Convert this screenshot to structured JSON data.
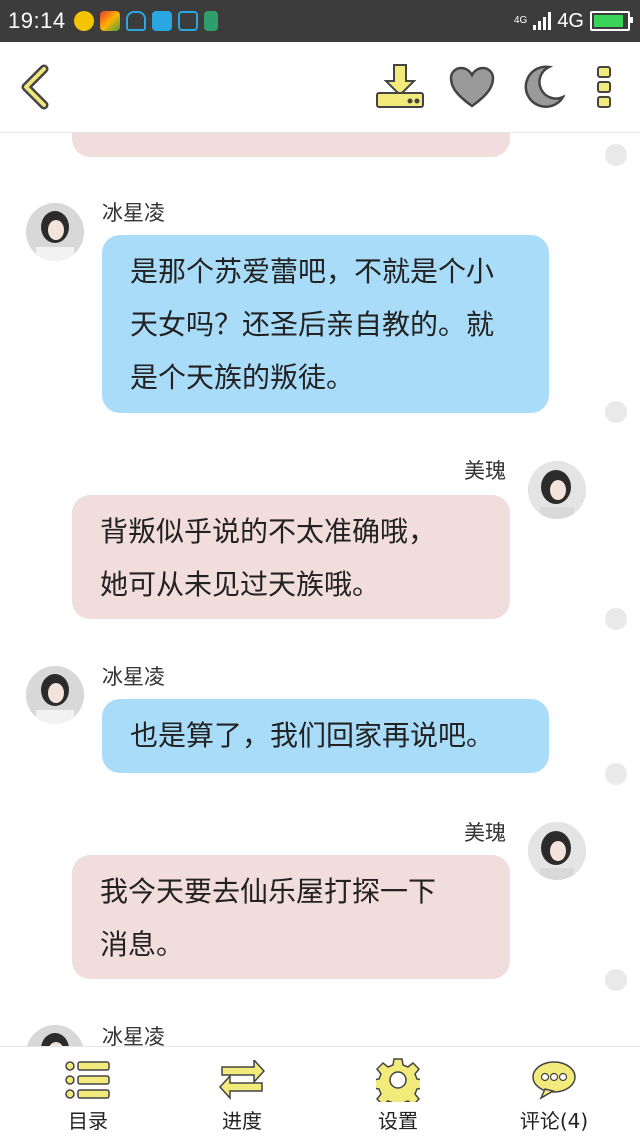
{
  "status_bar": {
    "time": "19:14",
    "network_small": "4G",
    "network": "4G",
    "icons": [
      "plus-app-icon",
      "color-app-icon",
      "headset-icon",
      "chat-app-icon",
      "scan-icon",
      "lock-icon"
    ]
  },
  "top_bar": {
    "icons": [
      "back-arrow-icon",
      "download-icon",
      "heart-icon",
      "night-mode-icon",
      "more-icon"
    ],
    "accent_color": "#e6df6a"
  },
  "messages": [
    {
      "speaker": "冰星凌",
      "side": "left",
      "color": "blue",
      "lines": [
        "是那个苏爱蕾吧，不就是个小",
        "天女吗？还圣后亲自教的。就",
        "是个天族的叛徒。"
      ]
    },
    {
      "speaker": "美瑰",
      "side": "right",
      "color": "pink",
      "lines": [
        "背叛似乎说的不太准确哦，",
        "她可从未见过天族哦。"
      ]
    },
    {
      "speaker": "冰星凌",
      "side": "left",
      "color": "blue",
      "lines": [
        "也是算了，我们回家再说吧。"
      ]
    },
    {
      "speaker": "美瑰",
      "side": "right",
      "color": "pink",
      "lines": [
        "我今天要去仙乐屋打探一下",
        "消息。"
      ]
    },
    {
      "speaker": "冰星凌",
      "side": "left",
      "color": "blue",
      "lines": []
    }
  ],
  "bottom_bar": {
    "items": [
      {
        "label": "目录",
        "icon": "list-icon"
      },
      {
        "label": "进度",
        "icon": "swap-arrows-icon"
      },
      {
        "label": "设置",
        "icon": "gear-icon"
      },
      {
        "label": "评论(4)",
        "icon": "comment-bubble-icon"
      }
    ]
  },
  "colors": {
    "blue_bubble": "#a8dcf9",
    "pink_bubble": "#f1dddb",
    "icon_yellow": "#f2ea7a"
  }
}
